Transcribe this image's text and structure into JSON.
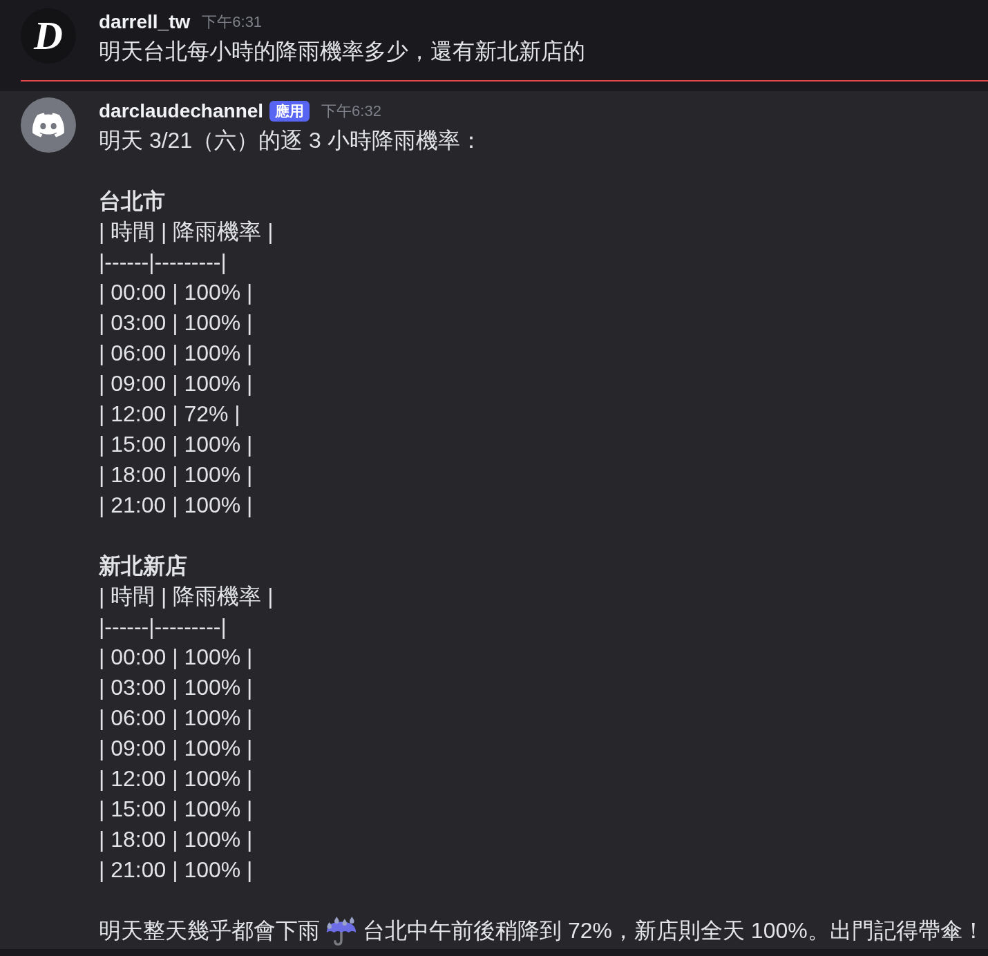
{
  "messages": [
    {
      "author": "darrell_tw",
      "time": "下午6:31",
      "avatar": {
        "kind": "letter",
        "letter": "D"
      },
      "highlighted": false,
      "unread_divider": true,
      "lines": [
        {
          "kind": "text",
          "text": "明天台北每小時的降雨機率多少，還有新北新店的"
        }
      ]
    },
    {
      "author": "darclaudechannel",
      "badge": "應用",
      "time": "下午6:32",
      "avatar": {
        "kind": "default"
      },
      "highlighted": true,
      "unread_divider": false,
      "lines": [
        {
          "kind": "text",
          "text": "明天 3/21（六）的逐 3 小時降雨機率："
        },
        {
          "kind": "blank"
        },
        {
          "kind": "heading",
          "text": "台北市"
        },
        {
          "kind": "text",
          "text": "| 時間 | 降雨機率 |"
        },
        {
          "kind": "text",
          "text": "|------|---------|"
        },
        {
          "kind": "text",
          "text": "| 00:00 | 100% |"
        },
        {
          "kind": "text",
          "text": "| 03:00 | 100% |"
        },
        {
          "kind": "text",
          "text": "| 06:00 | 100% |"
        },
        {
          "kind": "text",
          "text": "| 09:00 | 100% |"
        },
        {
          "kind": "text",
          "text": "| 12:00 | 72% |"
        },
        {
          "kind": "text",
          "text": "| 15:00 | 100% |"
        },
        {
          "kind": "text",
          "text": "| 18:00 | 100% |"
        },
        {
          "kind": "text",
          "text": "| 21:00 | 100% |"
        },
        {
          "kind": "blank"
        },
        {
          "kind": "heading",
          "text": "新北新店"
        },
        {
          "kind": "text",
          "text": "| 時間 | 降雨機率 |"
        },
        {
          "kind": "text",
          "text": "|------|---------|"
        },
        {
          "kind": "text",
          "text": "| 00:00 | 100% |"
        },
        {
          "kind": "text",
          "text": "| 03:00 | 100% |"
        },
        {
          "kind": "text",
          "text": "| 06:00 | 100% |"
        },
        {
          "kind": "text",
          "text": "| 09:00 | 100% |"
        },
        {
          "kind": "text",
          "text": "| 12:00 | 100% |"
        },
        {
          "kind": "text",
          "text": "| 15:00 | 100% |"
        },
        {
          "kind": "text",
          "text": "| 18:00 | 100% |"
        },
        {
          "kind": "text",
          "text": "| 21:00 | 100% |"
        },
        {
          "kind": "blank"
        },
        {
          "kind": "text_icon",
          "before": "明天整天幾乎都會下雨",
          "after": "台北中午前後稍降到 72%，新店則全天 100%。出門記得帶傘！"
        }
      ]
    }
  ]
}
